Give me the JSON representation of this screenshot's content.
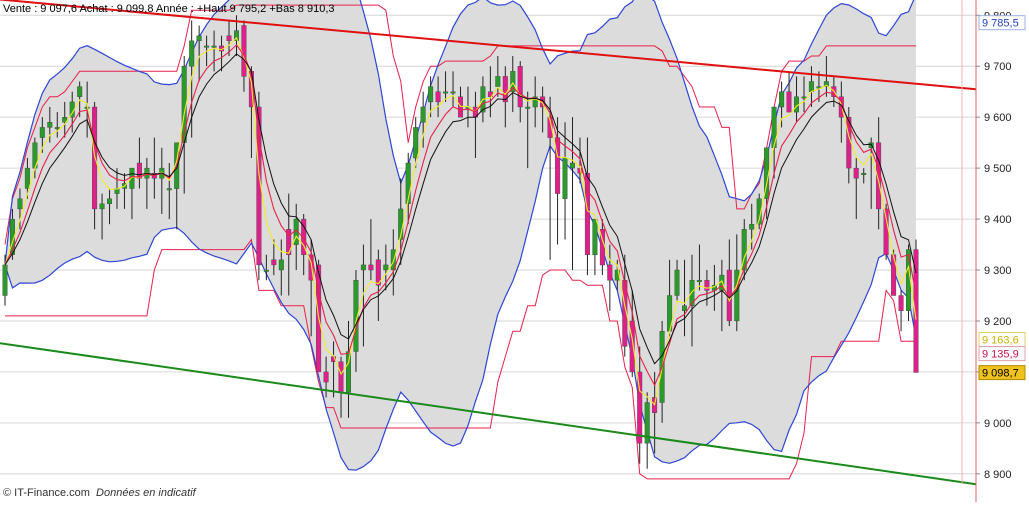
{
  "header": {
    "text": "Vente : 9 097,6 Achat : 9 099,8 Année : +Haut 9 795,2 +Bas 8 910,3"
  },
  "footer": {
    "copyright": "© IT-Finance.com",
    "note": "Données en indicatif"
  },
  "colors": {
    "band_fill": "#dcdcdc",
    "band_line": "#2d46d6",
    "ma_red": "#e8204a",
    "ma_black": "#111111",
    "ma_yellow": "#f2ec2a",
    "bull": "#2a9a2a",
    "bear": "#e0208a",
    "resistance": "#e01010",
    "support": "#1a8a1a",
    "grid": "#d6d6d6",
    "axis": "#e06060"
  },
  "chart_data": {
    "type": "candlestick",
    "title": "",
    "ylim": [
      8880,
      9830
    ],
    "yticks": [
      "8 900",
      "9 000",
      "9 100",
      "9 200",
      "9 300",
      "9 400",
      "9 500",
      "9 600",
      "9 700",
      "9 800"
    ],
    "ytick_values": [
      8900,
      9000,
      9100,
      9200,
      9300,
      9400,
      9500,
      9600,
      9700,
      9800
    ],
    "price_labels": [
      {
        "text": "9 785,5",
        "value": 9785.5,
        "style": "blue"
      },
      {
        "text": "9 163,6",
        "value": 9163.6,
        "style": "yellow"
      },
      {
        "text": "9 135,9",
        "value": 9135.9,
        "style": "red"
      },
      {
        "text": "9 098,7",
        "value": 9098.7,
        "style": "gold"
      }
    ],
    "candles": [
      [
        9250,
        9330,
        9230,
        9310
      ],
      [
        9330,
        9420,
        9320,
        9400
      ],
      [
        9420,
        9460,
        9380,
        9440
      ],
      [
        9460,
        9520,
        9440,
        9500
      ],
      [
        9500,
        9560,
        9480,
        9550
      ],
      [
        9560,
        9600,
        9530,
        9580
      ],
      [
        9580,
        9620,
        9550,
        9590
      ],
      [
        9580,
        9610,
        9560,
        9580
      ],
      [
        9590,
        9630,
        9560,
        9600
      ],
      [
        9600,
        9650,
        9570,
        9630
      ],
      [
        9640,
        9670,
        9600,
        9660
      ],
      [
        9620,
        9670,
        9560,
        9620
      ],
      [
        9620,
        9630,
        9380,
        9420
      ],
      [
        9420,
        9450,
        9360,
        9430
      ],
      [
        9430,
        9460,
        9390,
        9440
      ],
      [
        9450,
        9500,
        9420,
        9460
      ],
      [
        9460,
        9490,
        9420,
        9470
      ],
      [
        9460,
        9500,
        9400,
        9500
      ],
      [
        9510,
        9560,
        9460,
        9480
      ],
      [
        9480,
        9520,
        9420,
        9500
      ],
      [
        9490,
        9560,
        9440,
        9480
      ],
      [
        9480,
        9540,
        9410,
        9500
      ],
      [
        9460,
        9510,
        9400,
        9460
      ],
      [
        9460,
        9550,
        9380,
        9550
      ],
      [
        9550,
        9720,
        9450,
        9700
      ],
      [
        9700,
        9790,
        9560,
        9750
      ],
      [
        9750,
        9780,
        9670,
        9760
      ],
      [
        9740,
        9760,
        9700,
        9740
      ],
      [
        9740,
        9770,
        9690,
        9740
      ],
      [
        9740,
        9760,
        9690,
        9730
      ],
      [
        9760,
        9790,
        9720,
        9750
      ],
      [
        9750,
        9800,
        9720,
        9770
      ],
      [
        9780,
        9790,
        9650,
        9680
      ],
      [
        9690,
        9700,
        9520,
        9620
      ],
      [
        9620,
        9650,
        9280,
        9310
      ],
      [
        9300,
        9330,
        9280,
        9300
      ],
      [
        9320,
        9360,
        9290,
        9310
      ],
      [
        9300,
        9360,
        9250,
        9320
      ],
      [
        9380,
        9450,
        9250,
        9330
      ],
      [
        9350,
        9430,
        9300,
        9400
      ],
      [
        9400,
        9410,
        9290,
        9330
      ],
      [
        9330,
        9360,
        9170,
        9280
      ],
      [
        9310,
        9320,
        9100,
        9100
      ],
      [
        9100,
        9130,
        9050,
        9080
      ],
      [
        9130,
        9160,
        9050,
        9120
      ],
      [
        9120,
        9130,
        9010,
        9060
      ],
      [
        9060,
        9200,
        9010,
        9140
      ],
      [
        9140,
        9300,
        9100,
        9280
      ],
      [
        9300,
        9350,
        9150,
        9310
      ],
      [
        9310,
        9400,
        9280,
        9300
      ],
      [
        9320,
        9340,
        9200,
        9270
      ],
      [
        9300,
        9350,
        9260,
        9310
      ],
      [
        9300,
        9380,
        9250,
        9340
      ],
      [
        9360,
        9480,
        9310,
        9420
      ],
      [
        9430,
        9530,
        9390,
        9510
      ],
      [
        9520,
        9600,
        9500,
        9580
      ],
      [
        9590,
        9650,
        9540,
        9620
      ],
      [
        9630,
        9680,
        9600,
        9660
      ],
      [
        9650,
        9680,
        9600,
        9630
      ],
      [
        9650,
        9690,
        9630,
        9650
      ],
      [
        9650,
        9690,
        9620,
        9650
      ],
      [
        9640,
        9660,
        9600,
        9600
      ],
      [
        9620,
        9660,
        9580,
        9620
      ],
      [
        9620,
        9650,
        9520,
        9600
      ],
      [
        9610,
        9680,
        9590,
        9660
      ],
      [
        9650,
        9700,
        9600,
        9640
      ],
      [
        9660,
        9720,
        9640,
        9680
      ],
      [
        9680,
        9700,
        9580,
        9630
      ],
      [
        9650,
        9720,
        9610,
        9690
      ],
      [
        9700,
        9710,
        9590,
        9620
      ],
      [
        9620,
        9650,
        9500,
        9620
      ],
      [
        9620,
        9680,
        9580,
        9640
      ],
      [
        9640,
        9660,
        9570,
        9620
      ],
      [
        9600,
        9640,
        9320,
        9560
      ],
      [
        9560,
        9600,
        9350,
        9450
      ],
      [
        9440,
        9590,
        9360,
        9520
      ],
      [
        9500,
        9600,
        9300,
        9510
      ],
      [
        9500,
        9560,
        9470,
        9490
      ],
      [
        9490,
        9560,
        9290,
        9330
      ],
      [
        9330,
        9400,
        9290,
        9400
      ],
      [
        9380,
        9400,
        9290,
        9310
      ],
      [
        9310,
        9350,
        9220,
        9280
      ],
      [
        9280,
        9320,
        9260,
        9300
      ],
      [
        9280,
        9330,
        9130,
        9150
      ],
      [
        9200,
        9260,
        9090,
        9100
      ],
      [
        9100,
        9150,
        8920,
        8960
      ],
      [
        8960,
        9060,
        8910,
        9040
      ],
      [
        9050,
        9100,
        8940,
        9020
      ],
      [
        9040,
        9200,
        9000,
        9180
      ],
      [
        9180,
        9320,
        9170,
        9250
      ],
      [
        9250,
        9320,
        9240,
        9300
      ],
      [
        9220,
        9320,
        9170,
        9230
      ],
      [
        9230,
        9330,
        9150,
        9280
      ],
      [
        9280,
        9350,
        9260,
        9280
      ],
      [
        9280,
        9300,
        9230,
        9260
      ],
      [
        9260,
        9310,
        9220,
        9270
      ],
      [
        9260,
        9320,
        9180,
        9290
      ],
      [
        9300,
        9360,
        9190,
        9200
      ],
      [
        9200,
        9370,
        9180,
        9300
      ],
      [
        9300,
        9400,
        9280,
        9380
      ],
      [
        9380,
        9430,
        9340,
        9390
      ],
      [
        9390,
        9450,
        9380,
        9440
      ],
      [
        9440,
        9520,
        9400,
        9540
      ],
      [
        9540,
        9600,
        9480,
        9620
      ],
      [
        9620,
        9670,
        9580,
        9650
      ],
      [
        9650,
        9690,
        9610,
        9610
      ],
      [
        9610,
        9680,
        9590,
        9640
      ],
      [
        9640,
        9680,
        9610,
        9640
      ],
      [
        9650,
        9700,
        9620,
        9670
      ],
      [
        9660,
        9690,
        9630,
        9660
      ],
      [
        9660,
        9720,
        9640,
        9670
      ],
      [
        9660,
        9680,
        9620,
        9640
      ],
      [
        9640,
        9670,
        9550,
        9600
      ],
      [
        9600,
        9620,
        9470,
        9500
      ],
      [
        9500,
        9520,
        9400,
        9480
      ],
      [
        9490,
        9500,
        9470,
        9490
      ],
      [
        9540,
        9560,
        9420,
        9550
      ],
      [
        9550,
        9600,
        9380,
        9420
      ],
      [
        9420,
        9430,
        9320,
        9330
      ],
      [
        9330,
        9340,
        9260,
        9250
      ],
      [
        9250,
        9260,
        9180,
        9220
      ],
      [
        9220,
        9350,
        9200,
        9340
      ],
      [
        9340,
        9360,
        9220,
        9098.7
      ]
    ],
    "overlays": [
      "Bollinger upper",
      "Bollinger lower",
      "MA red",
      "MA black",
      "MA yellow"
    ],
    "trendlines": [
      {
        "name": "resistance",
        "from": [
          0,
          9830
        ],
        "to": [
          144,
          9636
        ]
      },
      {
        "name": "support",
        "from": [
          0,
          9155
        ],
        "to": [
          144,
          8850
        ]
      }
    ],
    "grid": true
  }
}
